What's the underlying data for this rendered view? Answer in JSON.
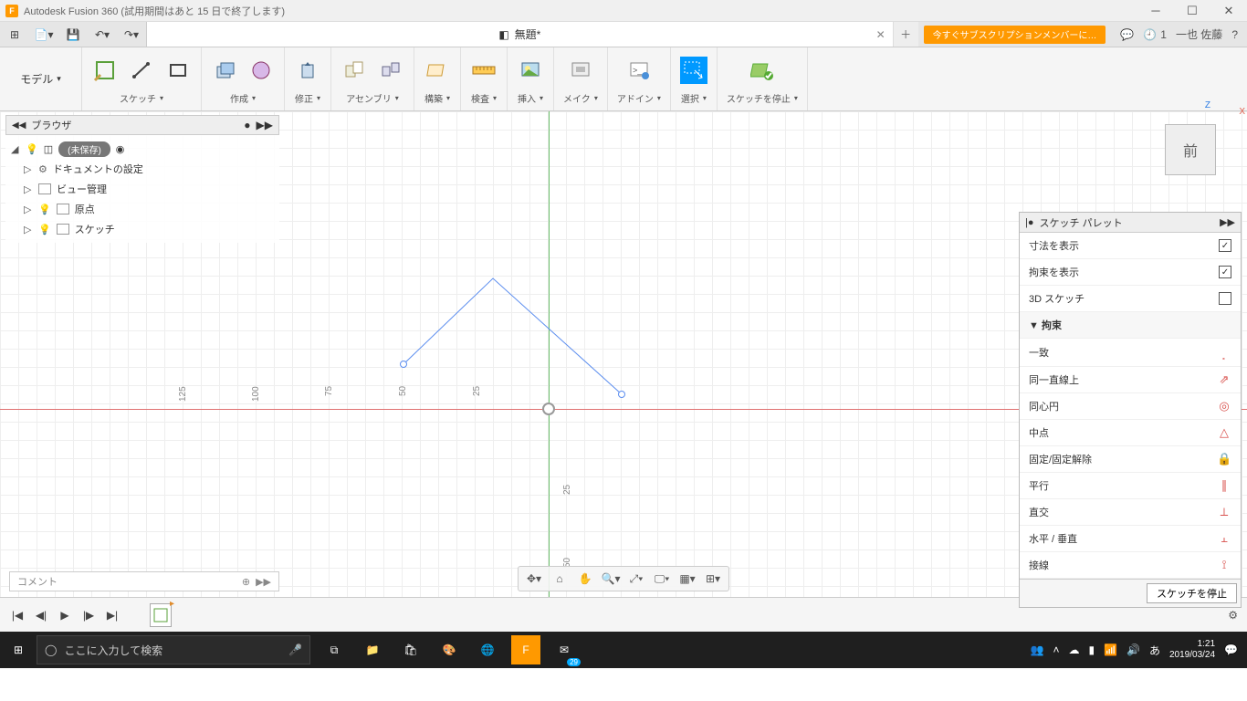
{
  "titlebar": {
    "app": "F",
    "title": "Autodesk Fusion 360 (試用期間はあと 15 日で終了します)"
  },
  "qat": {
    "doc_title": "無題*",
    "banner": "今すぐサブスクリプションメンバーに…",
    "job_count": "1",
    "user": "一也 佐藤"
  },
  "ribbon": {
    "model": "モデル",
    "groups": {
      "sketch": "スケッチ",
      "create": "作成",
      "modify": "修正",
      "assembly": "アセンブリ",
      "construct": "構築",
      "inspect": "検査",
      "insert": "挿入",
      "make": "メイク",
      "addins": "アドイン",
      "select": "選択",
      "stop": "スケッチを停止"
    }
  },
  "browser": {
    "header": "ブラウザ",
    "root": "(未保存)",
    "items": {
      "doc_settings": "ドキュメントの設定",
      "view_mgmt": "ビュー管理",
      "origin": "原点",
      "sketch": "スケッチ"
    }
  },
  "viewcube": {
    "face": "前",
    "z": "Z",
    "x": "X"
  },
  "ruler": {
    "n125": "125",
    "n100": "100",
    "n75": "75",
    "n50": "50",
    "n25": "25",
    "p25": "25",
    "p50": "50"
  },
  "palette": {
    "title": "スケッチ パレット",
    "show_dim": "寸法を表示",
    "show_con": "拘束を表示",
    "sketch3d": "3D スケッチ",
    "sec_constraint": "拘束",
    "c_coincident": "一致",
    "c_collinear": "同一直線上",
    "c_concentric": "同心円",
    "c_midpoint": "中点",
    "c_fix": "固定/固定解除",
    "c_parallel": "平行",
    "c_perp": "直交",
    "c_hv": "水平 / 垂直",
    "c_tangent": "接線",
    "stop_btn": "スケッチを停止"
  },
  "comment": {
    "placeholder": "コメント"
  },
  "taskbar": {
    "search": "ここに入力して検索",
    "time": "1:21",
    "date": "2019/03/24",
    "mail_badge": "29"
  }
}
